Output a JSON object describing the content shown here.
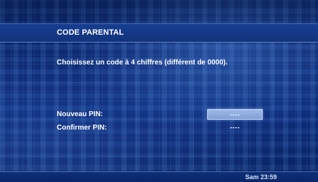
{
  "screen": {
    "title": "CODE PARENTAL",
    "instruction": "Choisissez un code à 4 chiffres (différent de 0000).",
    "fields": [
      {
        "label": "Nouveau PIN:",
        "value": "----",
        "focused": true
      },
      {
        "label": "Confirmer PIN:",
        "value": "----",
        "focused": false
      }
    ],
    "clock": "Sam 23:59"
  },
  "colors": {
    "background": "#0a2468",
    "header_band": "#173e91",
    "focus_field": "#9fb9e6",
    "text": "#ffffff"
  }
}
